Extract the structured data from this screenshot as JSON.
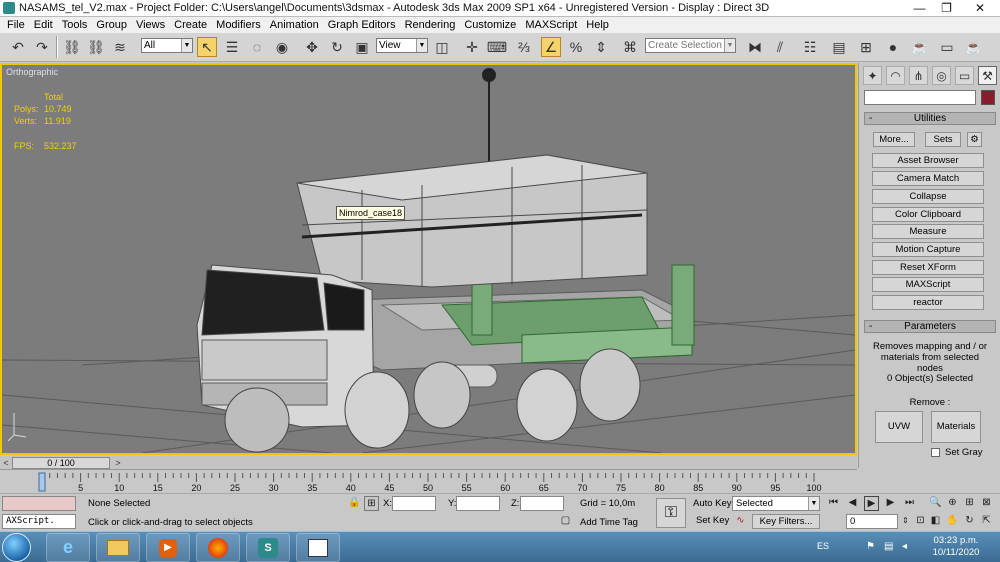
{
  "window": {
    "title": "NASAMS_tel_V2.max    - Project Folder: C:\\Users\\angel\\Documents\\3dsmax     - Autodesk 3ds Max  2009 SP1  x64   - Unregistered Version       - Display : Direct 3D",
    "min_glyph": "—",
    "restore_glyph": "❐",
    "close_glyph": "✕"
  },
  "menu": [
    "File",
    "Edit",
    "Tools",
    "Group",
    "Views",
    "Create",
    "Modifiers",
    "Animation",
    "Graph Editors",
    "Rendering",
    "Customize",
    "MAXScript",
    "Help"
  ],
  "toolbar": {
    "selection_filter": "All",
    "ref_coord": "View",
    "named_selection_placeholder": "Create Selection Set"
  },
  "viewport": {
    "name": "Orthographic",
    "stats_header": "Total",
    "polys_label": "Polys:",
    "polys_value": "10.749",
    "verts_label": "Verts:",
    "verts_value": "11.919",
    "fps_label": "FPS:",
    "fps_value": "532.237",
    "tooltip": "Nimrod_case18",
    "colors": {
      "background": "#7c7c7c",
      "active_border": "#f0c800",
      "stats": "#f2d200"
    }
  },
  "command_panel": {
    "utilities_title": "Utilities",
    "more_label": "More...",
    "sets_label": "Sets",
    "utility_buttons": [
      "Asset Browser",
      "Camera Match",
      "Collapse",
      "Color Clipboard",
      "Measure",
      "Motion Capture",
      "Reset XForm",
      "MAXScript",
      "reactor"
    ],
    "parameters_title": "Parameters",
    "description": "Removes mapping and / or materials from selected nodes",
    "selected_count": "0 Object(s) Selected",
    "remove_label": "Remove :",
    "uvw_label": "UVW",
    "materials_label": "Materials",
    "set_gray_label": "Set Gray",
    "object_color": "#8a1b2e"
  },
  "timeline": {
    "slider_label": "0 / 100",
    "ticks": [
      "0",
      "5",
      "10",
      "15",
      "20",
      "25",
      "30",
      "35",
      "40",
      "45",
      "50",
      "55",
      "60",
      "65",
      "70",
      "75",
      "80",
      "85",
      "90",
      "95",
      "100"
    ],
    "current_frame": 0,
    "total_frames": 100
  },
  "status": {
    "maxscript_label": "AXScript.",
    "selection_status": "None Selected",
    "prompt": "Click or click-and-drag to select objects",
    "x_label": "X:",
    "y_label": "Y:",
    "z_label": "Z:",
    "grid": "Grid = 10,0m",
    "add_time_tag": "Add Time Tag",
    "auto_key": "Auto Key",
    "set_key": "Set Key",
    "key_mode": "Selected",
    "key_filters": "Key Filters...",
    "frame_value": "0"
  },
  "taskbar": {
    "language": "ES",
    "time": "03:23 p.m.",
    "date": "10/11/2020"
  }
}
